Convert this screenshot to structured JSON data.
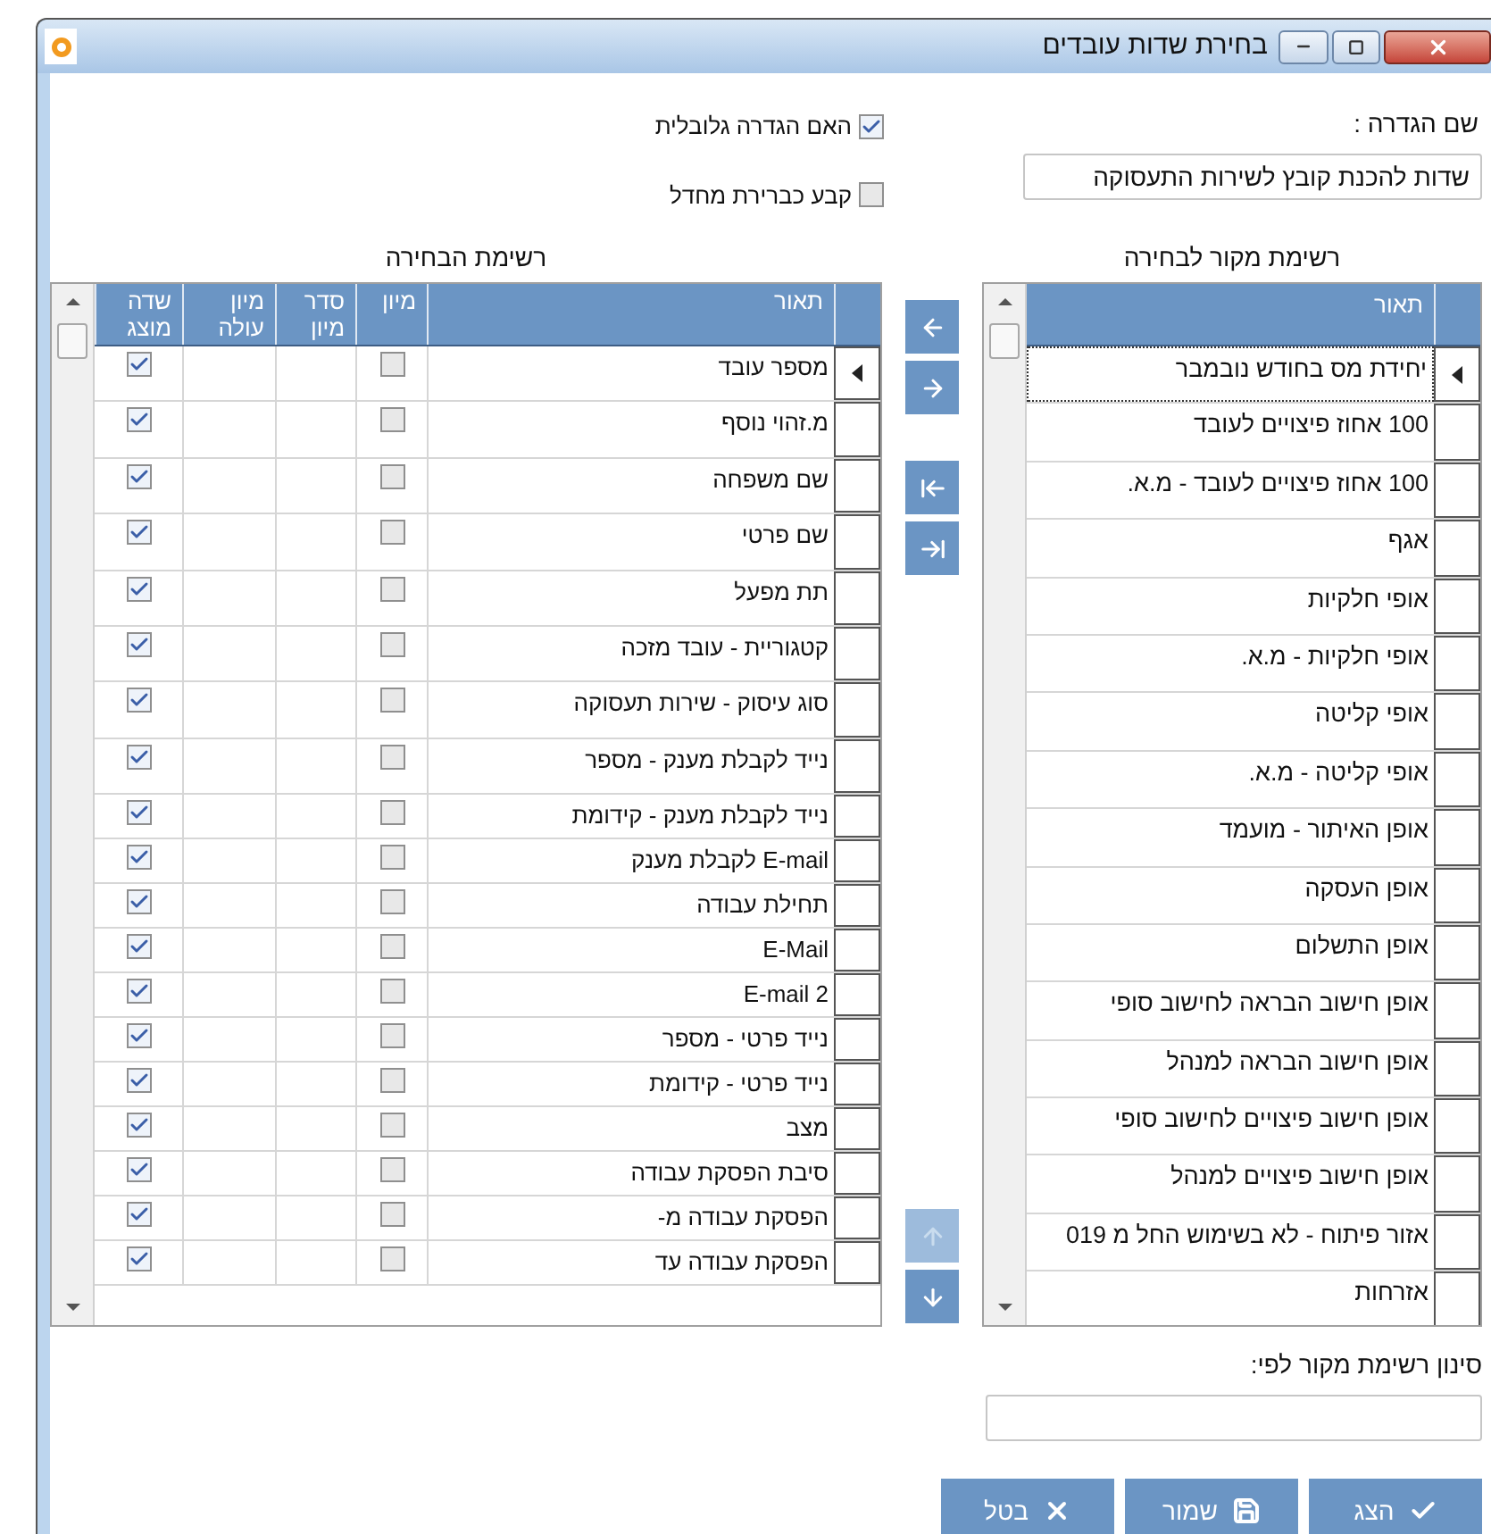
{
  "window": {
    "title": "בחירת שדות עובדים"
  },
  "definition": {
    "label": "שם הגדרה :",
    "value": "שדות להכנת קובץ לשירות התעסוקה"
  },
  "options": [
    {
      "label": "האם הגדרה גלובלית",
      "checked": true
    },
    {
      "label": "קבע כברירת מחדל",
      "checked": false
    }
  ],
  "selected_list": {
    "title": "רשימת הבחירה",
    "columns": [
      "תאור",
      "מיון",
      "סדר מיון",
      "מיון עולה",
      "שדה מוצג"
    ],
    "rows": [
      {
        "description": "מספר עובד",
        "sort": false,
        "displayed": true,
        "selected": true
      },
      {
        "description": "מ.זהוי נוסף",
        "sort": false,
        "displayed": true,
        "selected": false
      },
      {
        "description": "שם משפחה",
        "sort": false,
        "displayed": true,
        "selected": false
      },
      {
        "description": "שם פרטי",
        "sort": false,
        "displayed": true,
        "selected": false
      },
      {
        "description": "תת מפעל",
        "sort": false,
        "displayed": true,
        "selected": false
      },
      {
        "description": "קטגוריית - עובד מזכה",
        "sort": false,
        "displayed": true,
        "selected": false
      },
      {
        "description": "סוג עיסוק - שירות תעסוקה",
        "sort": false,
        "displayed": true,
        "selected": false
      },
      {
        "description": "נייד לקבלת מענק - מספר",
        "sort": false,
        "displayed": true,
        "selected": false
      },
      {
        "description": "נייד לקבלת מענק - קידומת",
        "sort": false,
        "displayed": true,
        "selected": false
      },
      {
        "description": "E-mail לקבלת מענק",
        "sort": false,
        "displayed": true,
        "selected": false
      },
      {
        "description": "תחילת עבודה",
        "sort": false,
        "displayed": true,
        "selected": false
      },
      {
        "description": "E-Mail",
        "sort": false,
        "displayed": true,
        "selected": false
      },
      {
        "description": "E-mail 2",
        "sort": false,
        "displayed": true,
        "selected": false
      },
      {
        "description": "נייד פרטי - מספר",
        "sort": false,
        "displayed": true,
        "selected": false
      },
      {
        "description": "נייד פרטי - קידומת",
        "sort": false,
        "displayed": true,
        "selected": false
      },
      {
        "description": "מצב",
        "sort": false,
        "displayed": true,
        "selected": false
      },
      {
        "description": "סיבת הפסקת עבודה",
        "sort": false,
        "displayed": true,
        "selected": false
      },
      {
        "description": "הפסקת עבודה מ-",
        "sort": false,
        "displayed": true,
        "selected": false
      },
      {
        "description": "הפסקת עבודה עד",
        "sort": false,
        "displayed": true,
        "selected": false
      }
    ]
  },
  "move_buttons": [
    {
      "kind": "left",
      "disabled": false
    },
    {
      "kind": "right",
      "disabled": false
    },
    {
      "kind": "left_all",
      "disabled": false
    },
    {
      "kind": "right_all",
      "disabled": false
    },
    {
      "kind": "up",
      "disabled": true
    },
    {
      "kind": "down",
      "disabled": false
    }
  ],
  "source_list": {
    "title": "רשימת מקור לבחירה",
    "columns": [
      "תאור"
    ],
    "rows": [
      {
        "description": "יחידת מס בחודש נובמבר",
        "selected": true
      },
      {
        "description": "100 אחוז פיצויים לעובד",
        "selected": false
      },
      {
        "description": "100 אחוז פיצויים לעובד - מ.א.",
        "selected": false
      },
      {
        "description": "אגף",
        "selected": false
      },
      {
        "description": "אופי חלקיות",
        "selected": false
      },
      {
        "description": "אופי חלקיות - מ.א.",
        "selected": false
      },
      {
        "description": "אופי קליטה",
        "selected": false
      },
      {
        "description": "אופי קליטה - מ.א.",
        "selected": false
      },
      {
        "description": "אופן האיתור - מועמד",
        "selected": false
      },
      {
        "description": "אופן העסקה",
        "selected": false
      },
      {
        "description": "אופן התשלום",
        "selected": false
      },
      {
        "description": "אופן חישוב הבראה לחישוב סופי",
        "selected": false
      },
      {
        "description": "אופן חישוב הבראה למנהל",
        "selected": false
      },
      {
        "description": "אופן חישוב פיצויים לחישוב סופי",
        "selected": false
      },
      {
        "description": "אופן חישוב פיצויים למנהל",
        "selected": false
      },
      {
        "description": "אזור פיתוח - לא בשימוש החל מ 019",
        "selected": false
      },
      {
        "description": "אזרחות",
        "selected": false
      }
    ]
  },
  "filter": {
    "label": "סינון רשימת מקור לפי:"
  },
  "buttons": [
    {
      "kind": "show",
      "label": "הצג"
    },
    {
      "kind": "save",
      "label": "שמור"
    },
    {
      "kind": "cancel",
      "label": "בטל"
    }
  ]
}
